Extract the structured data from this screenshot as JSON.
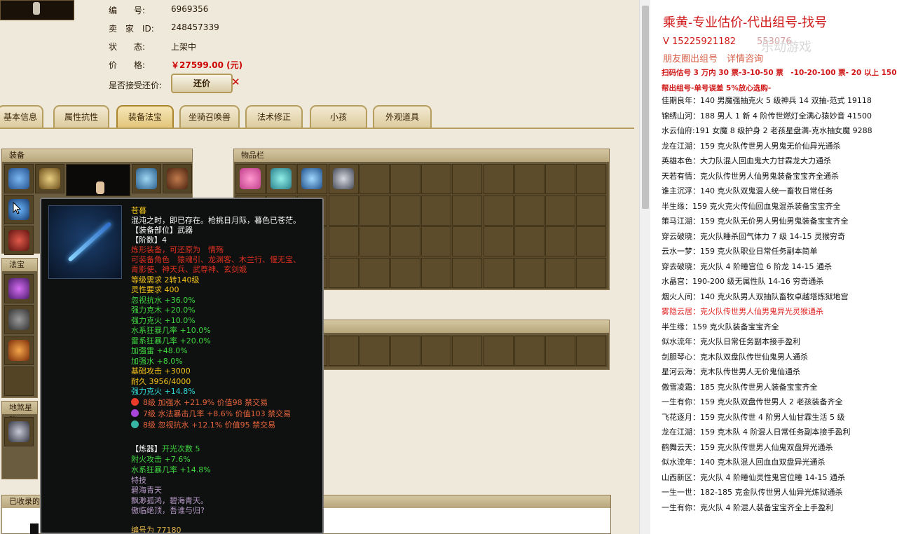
{
  "item": {
    "labels": [
      "编　　号:",
      "卖　家　ID:",
      "状　　态:",
      "价　　格:",
      "是否接受还价:"
    ],
    "number": "6969356",
    "seller_id": "248457339",
    "status": "上架中",
    "price": "￥27599.00 (元)",
    "bargain_button": "还价"
  },
  "tabs": [
    "基本信息",
    "属性抗性",
    "装备法宝",
    "坐骑召唤兽",
    "法术修正",
    "小孩",
    "外观道具"
  ],
  "active_tab": "装备法宝",
  "panels": {
    "equipment": "装备",
    "fabao": "法宝",
    "inventory": "物品栏",
    "ground": "地煞星阵",
    "collected": "已收录的"
  },
  "tooltip": {
    "name": "苍暮",
    "desc": "混沌之时，即已存在。枪挑日月际，暮色已苍茫。",
    "slot": "【装备部位】武器",
    "tier": "【阶数】4",
    "lines_red": [
      "炼形装备，可还原为　情殇",
      "可装备角色　猿魂引、龙渊客、木兰行、偃无宝、",
      "青影使、神天兵、武尊神、玄剑娥"
    ],
    "stats": [
      "等级需求 2转140级",
      "灵性要求 400",
      "忽视抗水 +36.0%",
      "强力克木 +20.0%",
      "强力克火 +10.0%",
      "水系狂暴几率 +10.0%",
      "雷系狂暴几率 +20.0%",
      "加强雷 +48.0%",
      "加强水 +8.0%",
      "基础攻击 +3000",
      "耐久 3956/4000"
    ],
    "special": "强力克火 +14.8%",
    "gems": [
      {
        "text": "8级 加强水 +21.9% 价值98 禁交易",
        "color": "#e83b2a"
      },
      {
        "text": "7级 水法暴击几率 +8.6% 价值103 禁交易",
        "color": "#a945d8"
      },
      {
        "text": "8级 忽视抗水 +12.1% 价值95 禁交易",
        "color": "#37b4a4"
      }
    ],
    "refine_head": "【炼器】",
    "refine_count": "开光次数 5",
    "refine_lines": [
      "附火攻击 +7.6%",
      "水系狂暴几率 +14.8%"
    ],
    "skill_title": "特技",
    "skill_name": "碧海青天",
    "skill_desc1": "飘渺孤鸿，碧海青天。",
    "skill_desc2": "傲临绝顶，吾谁与归?",
    "serial": "编号为 77180"
  },
  "right": {
    "title": "乘黄-专业估价-代出组号-找号",
    "phone": "V 15225921182",
    "phone_tail": "553076",
    "line2": "朋友圈出组号　详情咨询",
    "watermark": "乐动游戏",
    "line3": "扫码估号 3 万内 30 票-3-10-50 票　-10-20-100 票- 20 以上 150",
    "line4": "帮出组号-单号误差 5%放心选购-",
    "entries": [
      {
        "text": "佳期良年：140 男魔强抽克火 5 级神兵 14 双抽-范式 19118",
        "red": false
      },
      {
        "text": "锦绣山河：188 男人 1 新 4 阶传世燃灯全满心猿妙音 41500",
        "red": false
      },
      {
        "text": "水云仙府:191 女魔 8 级护身 2 老孩星盘满-克水抽女魔 9288",
        "red": false
      },
      {
        "text": "龙在江湖：159 克火队传世男人男鬼无价仙异光通杀",
        "red": false
      },
      {
        "text": "英雄本色：大力队混人回血鬼大力甘霖龙大力通杀",
        "red": false
      },
      {
        "text": "天若有情：克火队传世男人仙男鬼装备宝宝齐全通杀",
        "red": false
      },
      {
        "text": "谁主沉浮：140 克火队双鬼混人统一畜牧日常任务",
        "red": false
      },
      {
        "text": "半生缘：159 克火克火传仙回血鬼混杀装备宝宝齐全",
        "red": false
      },
      {
        "text": "策马江湖：159 克火队无价男人男仙男鬼装备宝宝齐全",
        "red": false
      },
      {
        "text": "穿云破晓：克火队睡杀回气体力 7 级 14-15 灵猴穷奇",
        "red": false
      },
      {
        "text": "云水一梦：159 克火队职业日常任务副本简单",
        "red": false
      },
      {
        "text": "穿去破晓：克火队 4 阶睡宫位 6 阶龙 14-15 通杀",
        "red": false
      },
      {
        "text": "水晶宫：190-200 级无属性队 14-16 穷奇通杀",
        "red": false
      },
      {
        "text": "烟火人间：140 克火队男人双抽队畜牧卓越塔炼狱地宫",
        "red": false
      },
      {
        "text": "雾隐云居：克火队传世男人仙男鬼异光灵猴通杀",
        "red": true
      },
      {
        "text": "半生缘：159 克火队装备宝宝齐全",
        "red": false
      },
      {
        "text": "似水流年：克火队日常任务副本接手盈利",
        "red": false
      },
      {
        "text": "剑胆琴心：克木队双盘队传世仙鬼男人通杀",
        "red": false
      },
      {
        "text": "星河云海：克木队传世男人无价鬼仙通杀",
        "red": false
      },
      {
        "text": "傲雪凌霜：185 克火队传世男人装备宝宝齐全",
        "red": false
      },
      {
        "text": "一生有你：159 克火队双盘传世男人 2 老孩装备齐全",
        "red": false
      },
      {
        "text": "飞花逐月：159 克火队传世 4 阶男人仙甘霖生活 5 级",
        "red": false
      },
      {
        "text": "龙在江湖：159 克木队 4 阶混人日常任务副本接手盈利",
        "red": false
      },
      {
        "text": "鹤舞云天：159 克火队传世男人仙鬼双盘异光通杀",
        "red": false
      },
      {
        "text": "似水流年：140 克木队混人回血血双盘异光通杀",
        "red": false
      },
      {
        "text": "山西新区：克火队 4 阶睡仙灵性鬼宫位睡 14-15 通杀",
        "red": false
      },
      {
        "text": "一生一世：182-185 克金队传世男人仙异光炼狱通杀",
        "red": false
      },
      {
        "text": "一生有你：克火队 4 阶混人装备宝宝齐全上手盈利",
        "red": false
      }
    ]
  }
}
